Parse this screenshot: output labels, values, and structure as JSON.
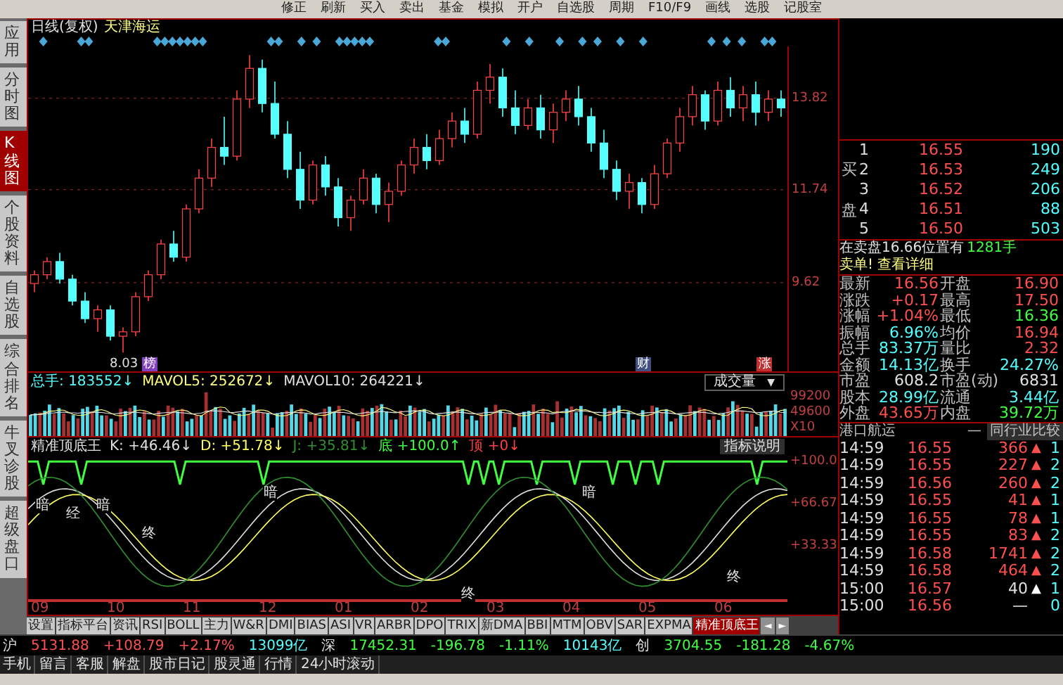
{
  "toolbar": [
    "修正",
    "刷新",
    "买入",
    "卖出",
    "基金",
    "模拟",
    "开户",
    "自选股",
    "周期",
    "F10/F9",
    "画线",
    "选股",
    "记股室"
  ],
  "sidebar": [
    {
      "label": "应用",
      "selected": false
    },
    {
      "label": "分时图",
      "selected": false
    },
    {
      "label": "K线图",
      "selected": true
    },
    {
      "label": "个股资料",
      "selected": false
    },
    {
      "label": "自选股",
      "selected": false
    },
    {
      "label": "综合排名",
      "selected": false
    },
    {
      "label": "牛叉诊股",
      "selected": false
    },
    {
      "label": "超级盘口",
      "selected": false
    }
  ],
  "chart": {
    "period": "日线(复权)",
    "stock": "天津海运",
    "low_label": "8.03",
    "chart_data": {
      "type": "candlestick",
      "grid": true,
      "ylim": [
        7.6,
        15
      ],
      "yticks": [
        {
          "value": 13.82,
          "label": "13.82"
        },
        {
          "value": 11.74,
          "label": "11.74"
        },
        {
          "value": 9.62,
          "label": "9.62"
        }
      ],
      "ohlc": [
        [
          9.6,
          9.9,
          9.4,
          9.8
        ],
        [
          9.8,
          10.2,
          9.7,
          10.1
        ],
        [
          10.1,
          10.3,
          9.6,
          9.7
        ],
        [
          9.7,
          9.8,
          9.1,
          9.2
        ],
        [
          9.2,
          9.4,
          8.7,
          8.8
        ],
        [
          8.8,
          9.1,
          8.5,
          9.0
        ],
        [
          9.0,
          9.1,
          8.3,
          8.4
        ],
        [
          8.4,
          8.6,
          8.03,
          8.5
        ],
        [
          8.5,
          9.4,
          8.4,
          9.3
        ],
        [
          9.3,
          9.9,
          9.2,
          9.8
        ],
        [
          9.8,
          10.6,
          9.7,
          10.5
        ],
        [
          10.5,
          10.8,
          10.1,
          10.2
        ],
        [
          10.2,
          11.4,
          10.1,
          11.3
        ],
        [
          11.3,
          12.2,
          11.2,
          12.0
        ],
        [
          12.0,
          12.9,
          11.8,
          12.7
        ],
        [
          12.7,
          13.4,
          12.3,
          12.5
        ],
        [
          12.5,
          14.0,
          12.4,
          13.8
        ],
        [
          13.8,
          14.8,
          13.6,
          14.5
        ],
        [
          14.5,
          14.7,
          13.5,
          13.7
        ],
        [
          13.7,
          14.2,
          12.9,
          13.0
        ],
        [
          13.0,
          13.3,
          12.0,
          12.2
        ],
        [
          12.2,
          12.6,
          11.3,
          11.5
        ],
        [
          11.5,
          12.4,
          11.4,
          12.3
        ],
        [
          12.3,
          12.5,
          11.6,
          11.8
        ],
        [
          11.8,
          12.0,
          10.9,
          11.1
        ],
        [
          11.1,
          11.6,
          10.8,
          11.5
        ],
        [
          11.5,
          12.2,
          11.4,
          12.0
        ],
        [
          12.0,
          12.1,
          11.2,
          11.4
        ],
        [
          11.4,
          11.9,
          11.0,
          11.7
        ],
        [
          11.7,
          12.4,
          11.6,
          12.3
        ],
        [
          12.3,
          12.9,
          12.1,
          12.7
        ],
        [
          12.7,
          13.0,
          12.2,
          12.4
        ],
        [
          12.4,
          13.1,
          12.3,
          12.9
        ],
        [
          12.9,
          13.5,
          12.7,
          13.3
        ],
        [
          13.3,
          13.6,
          12.8,
          13.0
        ],
        [
          13.0,
          14.2,
          12.9,
          14.0
        ],
        [
          14.0,
          14.6,
          13.7,
          14.3
        ],
        [
          14.3,
          14.5,
          13.4,
          13.6
        ],
        [
          13.6,
          14.0,
          13.0,
          13.2
        ],
        [
          13.2,
          13.8,
          13.1,
          13.6
        ],
        [
          13.6,
          13.9,
          12.9,
          13.1
        ],
        [
          13.1,
          13.7,
          12.8,
          13.5
        ],
        [
          13.5,
          14.0,
          13.3,
          13.8
        ],
        [
          13.8,
          14.1,
          13.2,
          13.4
        ],
        [
          13.4,
          13.6,
          12.6,
          12.8
        ],
        [
          12.8,
          13.1,
          12.0,
          12.2
        ],
        [
          12.2,
          12.4,
          11.5,
          11.7
        ],
        [
          11.7,
          12.1,
          11.3,
          11.9
        ],
        [
          11.9,
          12.0,
          11.2,
          11.4
        ],
        [
          11.4,
          12.3,
          11.3,
          12.1
        ],
        [
          12.1,
          12.9,
          12.0,
          12.8
        ],
        [
          12.8,
          13.6,
          12.6,
          13.4
        ],
        [
          13.4,
          14.1,
          13.2,
          13.9
        ],
        [
          13.9,
          14.0,
          13.1,
          13.3
        ],
        [
          13.3,
          14.2,
          13.2,
          14.0
        ],
        [
          14.0,
          14.3,
          13.4,
          13.6
        ],
        [
          13.6,
          14.1,
          13.3,
          13.9
        ],
        [
          13.9,
          14.2,
          13.2,
          13.5
        ],
        [
          13.5,
          14.0,
          13.3,
          13.8
        ],
        [
          13.8,
          14.0,
          13.4,
          13.6
        ]
      ]
    },
    "event_tags": [
      {
        "text": "榜",
        "color": "#8040c0"
      },
      {
        "text": "财",
        "color": "#405080"
      },
      {
        "text": "涨",
        "color": "#c03030"
      }
    ]
  },
  "volume": {
    "legend": [
      {
        "label": "总手:",
        "value": "183552",
        "arrow": "↓",
        "color": "#54ffff"
      },
      {
        "label": "MAVOL5:",
        "value": "252672",
        "arrow": "↓",
        "color": "#ffff80"
      },
      {
        "label": "MAVOL10:",
        "value": "264221",
        "arrow": "↓",
        "color": "#e0e0e0"
      }
    ],
    "selector": "成交量",
    "selector_icon": "▼",
    "ticks": [
      "99200",
      "49600",
      "X10"
    ]
  },
  "indicator": {
    "name": "精准顶底王",
    "legend": [
      {
        "label": "K:",
        "value": "+46.46",
        "arrow": "↓",
        "color": "#e0e0e0"
      },
      {
        "label": "D:",
        "value": "+51.78",
        "arrow": "↓",
        "color": "#ffff60"
      },
      {
        "label": "J:",
        "value": "+35.81",
        "arrow": "↓",
        "color": "#309030"
      },
      {
        "label": "底",
        "value": "+100.0",
        "arrow": "↑",
        "color": "#40ff40"
      },
      {
        "label": "顶",
        "value": "+0",
        "arrow": "↓",
        "color": "#ff4040"
      }
    ],
    "help": "指标说明",
    "ticks": [
      "+100.0",
      "+66.67",
      "+33.33"
    ],
    "signal_labels": [
      "暗",
      "经",
      "暗",
      "终",
      "暗",
      "终",
      "暗",
      "终"
    ]
  },
  "months": [
    "09",
    "10",
    "11",
    "12",
    "01",
    "02",
    "03",
    "04",
    "05",
    "06"
  ],
  "tabs": [
    {
      "label": "设置",
      "selected": false
    },
    {
      "label": "指标平台",
      "selected": false
    },
    {
      "label": "资讯",
      "selected": false
    },
    {
      "label": "RSI",
      "selected": false
    },
    {
      "label": "BOLL",
      "selected": false
    },
    {
      "label": "主力",
      "selected": false
    },
    {
      "label": "W&R",
      "selected": false
    },
    {
      "label": "DMI",
      "selected": false
    },
    {
      "label": "BIAS",
      "selected": false
    },
    {
      "label": "ASI",
      "selected": false
    },
    {
      "label": "VR",
      "selected": false
    },
    {
      "label": "ARBR",
      "selected": false
    },
    {
      "label": "DPO",
      "selected": false
    },
    {
      "label": "TRIX",
      "selected": false
    },
    {
      "label": "新DMA",
      "selected": false
    },
    {
      "label": "BBI",
      "selected": false
    },
    {
      "label": "MTM",
      "selected": false
    },
    {
      "label": "OBV",
      "selected": false
    },
    {
      "label": "SAR",
      "selected": false
    },
    {
      "label": "EXPMA",
      "selected": false
    },
    {
      "label": "精准顶底王",
      "selected": true
    }
  ],
  "tab_scroll": [
    "◄",
    "►"
  ],
  "order_book": {
    "side_labels": [
      "买",
      "盘"
    ],
    "rows": [
      {
        "rank": "1",
        "price": "16.55",
        "volume": "190"
      },
      {
        "rank": "2",
        "price": "16.53",
        "volume": "249"
      },
      {
        "rank": "3",
        "price": "16.52",
        "volume": "206"
      },
      {
        "rank": "4",
        "price": "16.51",
        "volume": "88"
      },
      {
        "rank": "5",
        "price": "16.50",
        "volume": "503"
      }
    ]
  },
  "notice": {
    "text": "在卖盘16.66位置有",
    "amount": "1281手",
    "action": "卖单! 查看详细"
  },
  "stats": [
    {
      "label": "最新",
      "value": "16.56",
      "color": "#ff5050"
    },
    {
      "label": "开盘",
      "value": "16.90",
      "color": "#ff5050"
    },
    {
      "label": "涨跌",
      "value": "+0.17",
      "color": "#ff5050"
    },
    {
      "label": "最高",
      "value": "17.50",
      "color": "#ff5050"
    },
    {
      "label": "涨幅",
      "value": "+1.04%",
      "color": "#ff5050"
    },
    {
      "label": "最低",
      "value": "16.36",
      "color": "#40ff40"
    },
    {
      "label": "振幅",
      "value": "6.96%",
      "color": "#54ffff"
    },
    {
      "label": "均价",
      "value": "16.94",
      "color": "#ff5050"
    },
    {
      "label": "总手",
      "value": "83.37万",
      "color": "#54ffff"
    },
    {
      "label": "量比",
      "value": "2.32",
      "color": "#ff5050"
    },
    {
      "label": "金额",
      "value": "14.13亿",
      "color": "#54ffff"
    },
    {
      "label": "换手",
      "value": "24.27%",
      "color": "#54ffff"
    },
    {
      "label": "市盈",
      "value": "608.2",
      "color": "#e0e0e0"
    },
    {
      "label": "市盈(动)",
      "value": "6831",
      "color": "#e0e0e0"
    },
    {
      "label": "股本",
      "value": "28.99亿",
      "color": "#54ffff"
    },
    {
      "label": "流通",
      "value": "3.44亿",
      "color": "#54ffff"
    },
    {
      "label": "外盘",
      "value": "43.65万",
      "color": "#ff5050"
    },
    {
      "label": "内盘",
      "value": "39.72万",
      "color": "#40ff40"
    }
  ],
  "industry": {
    "name": "港口航运",
    "dash": "—",
    "compare": "同行业比较"
  },
  "trades": [
    {
      "time": "14:59",
      "price": "16.55",
      "volume": "366",
      "arrow": "▲",
      "kind": "buy",
      "column_4": "1"
    },
    {
      "time": "14:59",
      "price": "16.55",
      "volume": "227",
      "arrow": "▲",
      "kind": "buy",
      "column_4": "2"
    },
    {
      "time": "14:59",
      "price": "16.56",
      "volume": "260",
      "arrow": "▲",
      "kind": "buy",
      "column_4": "2"
    },
    {
      "time": "14:59",
      "price": "16.55",
      "volume": "41",
      "arrow": "▲",
      "kind": "buy",
      "column_4": "1"
    },
    {
      "time": "14:59",
      "price": "16.55",
      "volume": "78",
      "arrow": "▲",
      "kind": "buy",
      "column_4": "1"
    },
    {
      "time": "14:59",
      "price": "16.55",
      "volume": "83",
      "arrow": "▲",
      "kind": "buy",
      "column_4": "2"
    },
    {
      "time": "14:59",
      "price": "16.58",
      "volume": "1741",
      "arrow": "▲",
      "kind": "buy",
      "column_4": "2"
    },
    {
      "time": "14:59",
      "price": "16.58",
      "volume": "464",
      "arrow": "▲",
      "kind": "buy",
      "column_4": "2"
    },
    {
      "time": "15:00",
      "price": "16.57",
      "volume": "40",
      "arrow": "▲",
      "kind": "neutral",
      "column_4": "1"
    },
    {
      "time": "15:00",
      "price": "16.56",
      "volume": "—",
      "kind": "none",
      "column_4": "0"
    }
  ],
  "indices": [
    {
      "name": "沪",
      "value": "5131.88",
      "change": "+108.79",
      "percent": "+2.17%",
      "turnover": "13099亿",
      "up": true
    },
    {
      "name": "深",
      "value": "17452.31",
      "change": "-196.78",
      "percent": "-1.11%",
      "turnover": "10143亿",
      "up": false
    },
    {
      "name": "创",
      "value": "3704.55",
      "change": "-181.28",
      "percent": "-4.67%",
      "up": false
    }
  ],
  "bottom_bar": [
    "手机",
    "留言",
    "客服",
    "解盘",
    "股市日记",
    "股灵通",
    "行情",
    "24小时滚动"
  ]
}
